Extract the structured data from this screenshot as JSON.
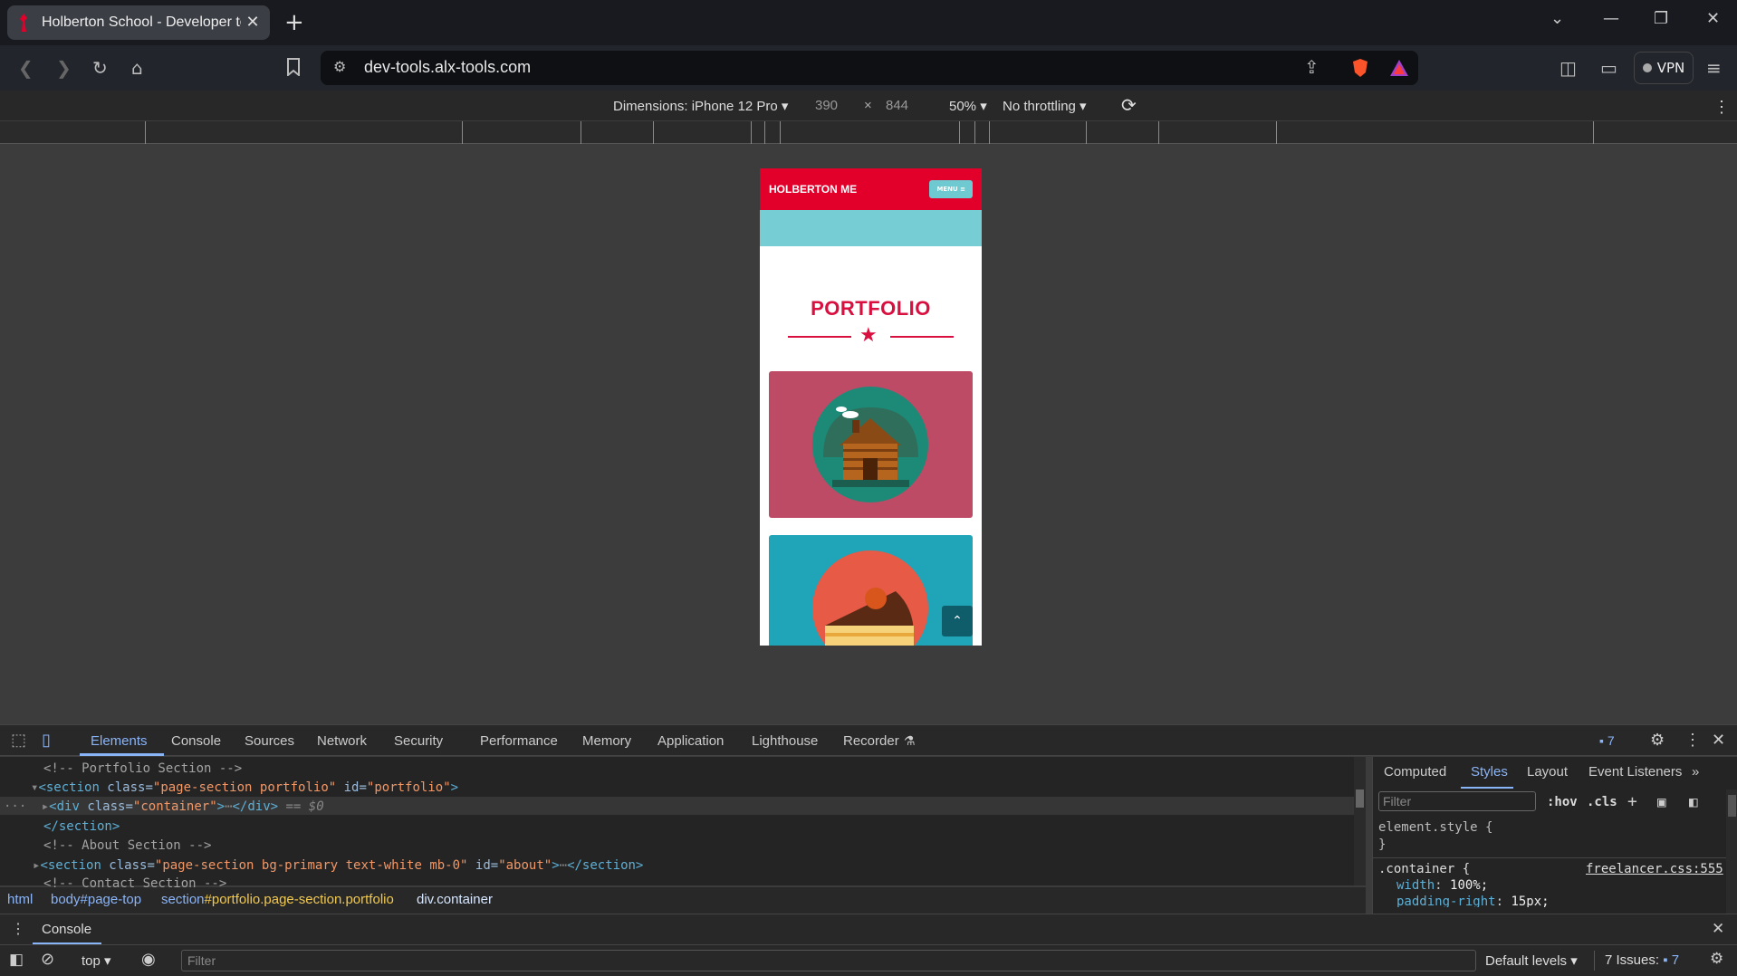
{
  "browser": {
    "tab_title": "Holberton School - Developer to",
    "url": "dev-tools.alx-tools.com",
    "vpn_label": "VPN"
  },
  "device_toolbar": {
    "dimensions": "Dimensions: iPhone 12 Pro",
    "width": "390",
    "times": "×",
    "height": "844",
    "zoom": "50%",
    "throttling": "No throttling"
  },
  "page": {
    "brand": "HOLBERTON ME",
    "menu_label": "MENU ≡",
    "section_title": "PORTFOLIO",
    "colors": {
      "primary": "#e2002b",
      "accent": "#76cdd3",
      "card1": "#be4b66",
      "card2": "#20a4b8"
    }
  },
  "devtools": {
    "tabs": [
      "Elements",
      "Console",
      "Sources",
      "Network",
      "Security",
      "Performance",
      "Memory",
      "Application",
      "Lighthouse",
      "Recorder"
    ],
    "issues_badge": "7",
    "code": {
      "c1": "<!-- Portfolio Section -->",
      "s_open": "<section",
      "s_class_attr": " class=",
      "s_class_val": "\"page-section portfolio\"",
      "s_id_attr": " id=",
      "s_id_val": "\"portfolio\"",
      "gt": ">",
      "div_open": "<div",
      "div_class_attr": " class=",
      "div_class_val": "\"container\"",
      "div_gt": ">",
      "div_close": "</div>",
      "div_eq": " == $0",
      "s_close": "</section>",
      "c2": "<!-- About Section -->",
      "s2_open": "<section",
      "s2_class_attr": " class=",
      "s2_class_val": "\"page-section bg-primary text-white mb-0\"",
      "s2_id_attr": " id=",
      "s2_id_val": "\"about\"",
      "s2_close": "</section>",
      "c3": "<!-- Contact Section -->"
    },
    "breadcrumbs": {
      "html": "html",
      "body": "body#page-top",
      "section_tag": "section",
      "section_rest": "#portfolio.page-section.portfolio",
      "div": "div.container"
    },
    "styles_tabs": [
      "Computed",
      "Styles",
      "Layout",
      "Event Listeners"
    ],
    "filter_placeholder": "Filter",
    "hov": ":hov",
    "cls": ".cls",
    "element_style": "element.style {",
    "close_brace": "}",
    "rule_selector": ".container {",
    "rule_source": "freelancer.css:555",
    "prop1_name": "width",
    "prop1_val": "100%;",
    "prop2_name": "padding-right",
    "prop2_val": "15px;"
  },
  "console": {
    "label": "Console",
    "context": "top",
    "filter_placeholder": "Filter",
    "levels": "Default levels",
    "issues_label": "7 Issues:",
    "issues_count": "7"
  }
}
